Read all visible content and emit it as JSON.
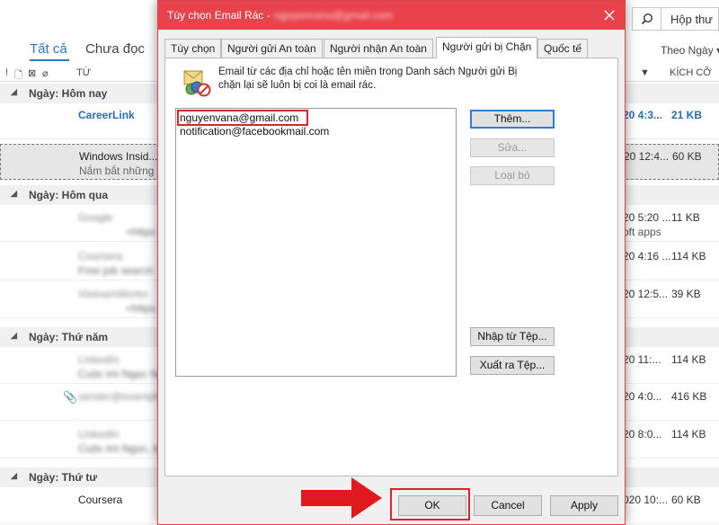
{
  "background": {
    "search_label": "Hộp thư",
    "tabs": {
      "all": "Tất cả",
      "unread": "Chưa đọc"
    },
    "sort_label": "Theo Ngày",
    "columns": {
      "from": "TỪ",
      "size": "KÍCH CỠ"
    },
    "groups": {
      "today": "Ngày: Hôm nay",
      "yesterday": "Ngày: Hôm qua",
      "thursday": "Ngày: Thứ năm",
      "wednesday": "Ngày: Thứ tư"
    },
    "rows": [
      {
        "sender": "CareerLink",
        "preview": "",
        "date": "20 4:3...",
        "size": "21 KB",
        "extra": ""
      },
      {
        "sender": "Windows Insid...",
        "preview": "Nắm bắt những",
        "date": "20 12:4...",
        "size": "60 KB",
        "extra": ""
      },
      {
        "sender": "Google",
        "preview": "<https",
        "date": "20 5:20 ...",
        "size": "11 KB",
        "extra": "oft apps"
      },
      {
        "sender": "Coursera",
        "preview": "Free job search",
        "date": "20 4:16 ...",
        "size": "114 KB",
        "extra": ""
      },
      {
        "sender": "VietnamWorks",
        "preview": "<https",
        "date": "20 12:5...",
        "size": "39 KB",
        "extra": ""
      },
      {
        "sender": "LinkedIn",
        "preview": "Cuộc trò Ngọc Ngà",
        "date": "20 11:...",
        "size": "114 KB",
        "extra": ""
      },
      {
        "sender": "sender@example.com",
        "preview": "",
        "date": "20 4:0...",
        "size": "416 KB",
        "extra": ""
      },
      {
        "sender": "LinkedIn",
        "preview": "Cuộc trò Ngọc, bạn",
        "date": "20 8:0...",
        "size": "114 KB",
        "extra": ""
      },
      {
        "sender": "Coursera",
        "preview": "",
        "date": "020 10:...",
        "size": "60 KB",
        "extra": ""
      }
    ]
  },
  "dialog": {
    "title": "Tùy chọn Email Rác -",
    "title_email": "nguyenvana@gmail.com",
    "tabs": [
      "Tùy chọn",
      "Người gửi An toàn",
      "Người nhận An toàn",
      "Người gửi bị Chặn",
      "Quốc tế"
    ],
    "active_tab": "Người gửi bị Chặn",
    "info_text": "Email từ các địa chỉ hoặc tên miền trong Danh sách Người gửi Bị chặn lại sẽ luôn bị coi là email rác.",
    "blocked_list": [
      "nguyenvana@gmail.com",
      "notification@facebookmail.com"
    ],
    "buttons": {
      "add": "Thêm...",
      "edit": "Sửa...",
      "remove": "Loại bỏ",
      "import": "Nhập từ Tệp...",
      "export": "Xuất ra Tệp..."
    },
    "footer": {
      "ok": "OK",
      "cancel": "Cancel",
      "apply": "Apply"
    },
    "colors": {
      "title_bar": "#e8434c",
      "highlight": "#d6262b"
    }
  }
}
